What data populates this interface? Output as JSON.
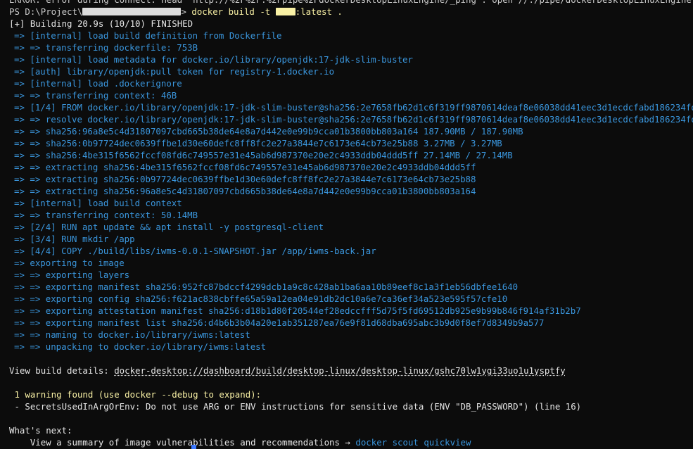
{
  "terminal": {
    "top_line": "ERROR: error during connect: Head \"http://%2F%2F.%2Fpipe%2FdockerDesktopLinuxEngine/_ping\": open //./pipe/dockerDesktopLinuxEngine: The sys",
    "prompt": "PS D:\\Project\\",
    "prompt_end": ">",
    "command_a": "docker build -t ",
    "command_b": ":latest .",
    "build_header": "[+] Building 20.9s (10/10) FINISHED",
    "steps": [
      "=> [internal] load build definition from Dockerfile",
      "=> => transferring dockerfile: 753B",
      "=> [internal] load metadata for docker.io/library/openjdk:17-jdk-slim-buster",
      "=> [auth] library/openjdk:pull token for registry-1.docker.io",
      "=> [internal] load .dockerignore",
      "=> => transferring context: 46B",
      "=> [1/4] FROM docker.io/library/openjdk:17-jdk-slim-buster@sha256:2e7658fb62d1c6f319ff9870614deaf8e06038dd41eec3d1ecdcfabd186234fd",
      "=> => resolve docker.io/library/openjdk:17-jdk-slim-buster@sha256:2e7658fb62d1c6f319ff9870614deaf8e06038dd41eec3d1ecdcfabd186234fd",
      "=> => sha256:96a8e5c4d31807097cbd665b38de64e8a7d442e0e99b9cca01b3800bb803a164 187.90MB / 187.90MB",
      "=> => sha256:0b97724dec0639ffbe1d30e60defc8ff8fc2e27a3844e7c6173e64cb73e25b88 3.27MB / 3.27MB",
      "=> => sha256:4be315f6562fccf08fd6c749557e31e45ab6d987370e20e2c4933ddb04ddd5ff 27.14MB / 27.14MB",
      "=> => extracting sha256:4be315f6562fccf08fd6c749557e31e45ab6d987370e20e2c4933ddb04ddd5ff",
      "=> => extracting sha256:0b97724dec0639ffbe1d30e60defc8ff8fc2e27a3844e7c6173e64cb73e25b88",
      "=> => extracting sha256:96a8e5c4d31807097cbd665b38de64e8a7d442e0e99b9cca01b3800bb803a164",
      "=> [internal] load build context",
      "=> => transferring context: 50.14MB",
      "=> [2/4] RUN apt update && apt install -y postgresql-client",
      "=> [3/4] RUN mkdir /app",
      "=> [4/4] COPY ./build/libs/iwms-0.0.1-SNAPSHOT.jar /app/iwms-back.jar",
      "=> exporting to image",
      "=> => exporting layers",
      "=> => exporting manifest sha256:952fc87bdccf4299dcb1a9c8c428ab1ba6aa10b89eef8c1a3f1eb56dbfee1640",
      "=> => exporting config sha256:f621ac838cbffe65a59a12ea04e91db2dc10a6e7ca36ef34a523e595f57cfe10",
      "=> => exporting attestation manifest sha256:d18b1d80f20544ef28edccfff5d75f5fd69512db925e9b99b846f914af31b2b7",
      "=> => exporting manifest list sha256:d4b6b3b04a20e1ab351287ea76e9f81d68dba695abc3b9d0f8ef7d8349b9a577",
      "=> => naming to docker.io/library/iwms:latest",
      "=> => unpacking to docker.io/library/iwms:latest"
    ],
    "view_label": "View build details: ",
    "view_link": "docker-desktop://dashboard/build/desktop-linux/desktop-linux/gshc70lw1ygi33uo1u1ysptfy",
    "warning_header": " 1 warning found (use docker --debug to expand):",
    "warning_detail": " - SecretsUsedInArgOrEnv: Do not use ARG or ENV instructions for sensitive data (ENV \"DB_PASSWORD\") (line 16)",
    "whats_next": "What's next:",
    "next_text": "    View a summary of image vulnerabilities and recommendations → ",
    "next_cmd": "docker scout quickview"
  },
  "colors": {
    "background": "#0c0c0c",
    "text": "#cccccc",
    "step_cyan": "#3a96dd",
    "command_yellow": "#f9f1a5",
    "cursor": "#3b78ff"
  }
}
